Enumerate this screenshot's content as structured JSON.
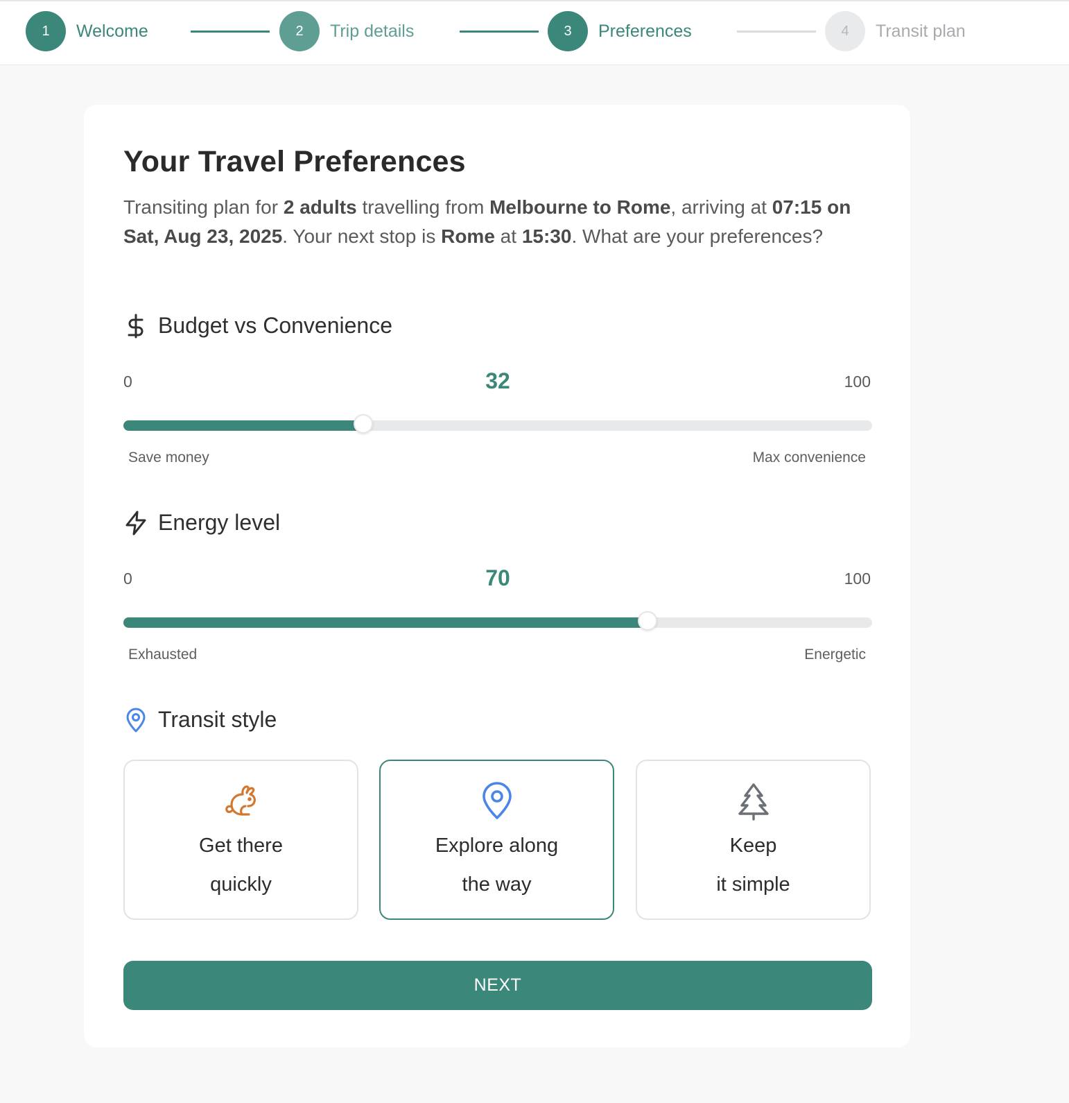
{
  "stepper": {
    "steps": [
      {
        "number": "1",
        "label": "Welcome",
        "state": "completed"
      },
      {
        "number": "2",
        "label": "Trip details",
        "state": "completed"
      },
      {
        "number": "3",
        "label": "Preferences",
        "state": "current"
      },
      {
        "number": "4",
        "label": "Transit plan",
        "state": "upcoming"
      }
    ]
  },
  "card": {
    "title": "Your Travel Preferences",
    "intro": {
      "p1": "Transiting plan for ",
      "adults": "2 adults",
      "p2": " travelling from ",
      "route": "Melbourne to Rome",
      "p3": ", arriving at ",
      "arrival": "07:15 on Sat, Aug 23, 2025",
      "p4": ". Your next stop is ",
      "next_stop": "Rome",
      "p5": " at ",
      "next_time": "15:30",
      "p6": ". What are your preferences?"
    },
    "budget": {
      "heading": "Budget vs Convenience",
      "icon": "dollar-icon",
      "min": "0",
      "max": "100",
      "value": 32,
      "value_label": "32",
      "hint_left": "Save money",
      "hint_right": "Max convenience"
    },
    "energy": {
      "heading": "Energy level",
      "icon": "lightning-icon",
      "min": "0",
      "max": "100",
      "value": 70,
      "value_label": "70",
      "hint_left": "Exhausted",
      "hint_right": "Energetic"
    },
    "transit_style": {
      "heading": "Transit style",
      "icon": "map-pin-icon",
      "selected": 1,
      "options": [
        {
          "line1": "Get there",
          "line2": "quickly",
          "icon": "rabbit-icon",
          "icon_color": "#d2782f"
        },
        {
          "line1": "Explore along",
          "line2": "the way",
          "icon": "map-pin-icon",
          "icon_color": "#4a86e8"
        },
        {
          "line1": "Keep",
          "line2": "it simple",
          "icon": "tree-icon",
          "icon_color": "#6b6f78"
        }
      ]
    },
    "next_button": "NEXT"
  },
  "colors": {
    "accent": "#3b8779",
    "track": "#e8e9eb",
    "pin_blue": "#4a86e8",
    "rabbit_orange": "#d2782f"
  }
}
